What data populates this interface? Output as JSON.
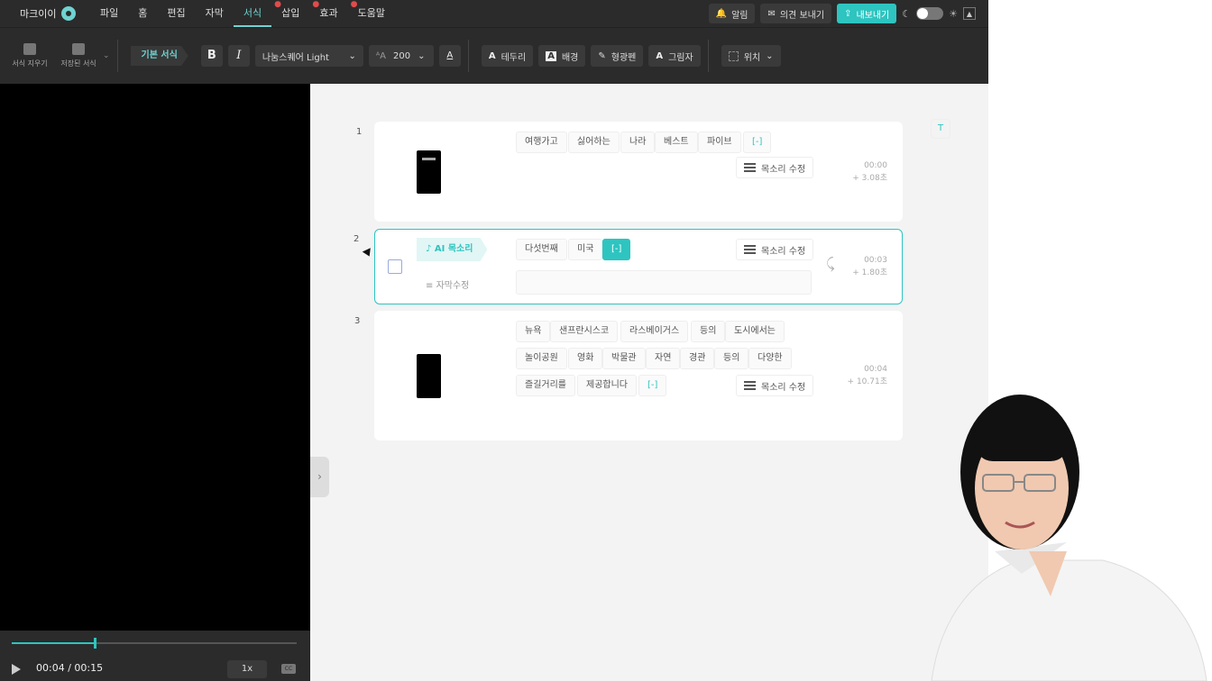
{
  "menubar": {
    "brand": "마크이이",
    "items": [
      {
        "label": "파일",
        "dot": false
      },
      {
        "label": "홈",
        "dot": false
      },
      {
        "label": "편집",
        "dot": false
      },
      {
        "label": "자막",
        "dot": false
      },
      {
        "label": "서식",
        "dot": false,
        "active": true
      },
      {
        "label": "삽입",
        "dot": true
      },
      {
        "label": "효과",
        "dot": true
      },
      {
        "label": "도움말",
        "dot": true
      }
    ],
    "alert": "알림",
    "feedback": "의견 보내기",
    "export": "내보내기"
  },
  "toolbar": {
    "clear_format": "서식 지우기",
    "saved_format": "저장된 서식",
    "basic_format": "기본 서식",
    "bold": "B",
    "italic": "I",
    "font": "나눔스퀘어 Light",
    "size": "200",
    "border": "테두리",
    "background": "배경",
    "highlight": "형광펜",
    "shadow": "그림자",
    "position": "위치"
  },
  "player": {
    "time": "00:04 / 00:15",
    "speed": "1x",
    "progress": 0.29
  },
  "scenes": [
    {
      "num": "1",
      "chips": [
        "여행가고",
        "싫어하는",
        "나라",
        "베스트",
        "파이브",
        "[-]"
      ],
      "voice_edit": "목소리 수정",
      "time": "00:00",
      "duration": "+ 3.08초"
    },
    {
      "num": "2",
      "ai_voice": "AI 목소리",
      "chips": [
        "다섯번째",
        "미국",
        "[-]"
      ],
      "voice_edit": "목소리 수정",
      "subtitle_edit": "자막수정",
      "time": "00:03",
      "duration": "+ 1.80초"
    },
    {
      "num": "3",
      "row1": [
        "뉴욕",
        "샌프란시스코",
        "라스베이거스",
        "등의",
        "도시에서는"
      ],
      "row2": [
        "놀이공원",
        "영화",
        "박물관",
        "자연",
        "경관",
        "등의",
        "다양한"
      ],
      "row3": [
        "즐길거리를",
        "제공합니다",
        "[-]"
      ],
      "voice_edit": "목소리 수정",
      "time": "00:04",
      "duration": "+ 10.71초"
    }
  ],
  "colors": {
    "accent": "#2ec4c0",
    "dark": "#2b2b2b"
  }
}
